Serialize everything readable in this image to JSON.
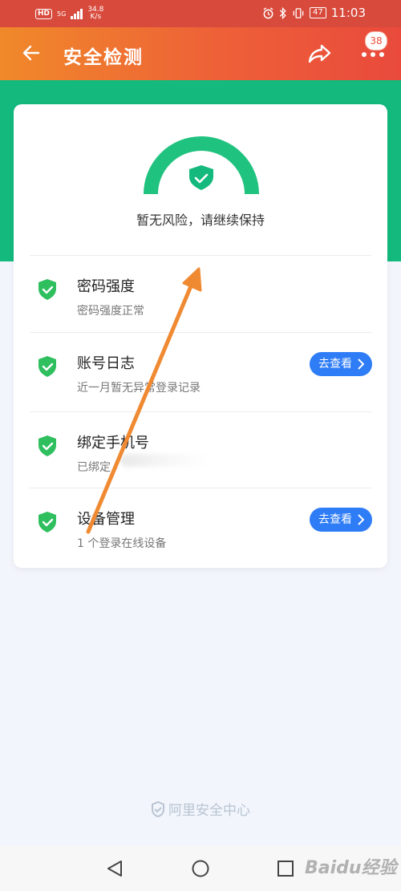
{
  "status_bar": {
    "hd": "HD",
    "network_type": "5G",
    "speed_value": "34.8",
    "speed_unit": "K/s",
    "battery": "47",
    "time": "11:03"
  },
  "header": {
    "title": "安全检测",
    "badge_count": "38"
  },
  "summary": {
    "status_text": "暂无风险，请继续保持"
  },
  "items": [
    {
      "name": "密码强度",
      "desc": "密码强度正常",
      "action": ""
    },
    {
      "name": "账号日志",
      "desc": "近一月暂无异常登录记录",
      "action": "去查看"
    },
    {
      "name": "绑定手机号",
      "desc": "已绑定",
      "action": ""
    },
    {
      "name": "设备管理",
      "desc": "1 个登录在线设备",
      "action": "去查看"
    }
  ],
  "footer": {
    "brand": "阿里安全中心"
  },
  "watermark": "Baidu经验",
  "colors": {
    "header_start": "#f0892a",
    "header_end": "#e94a3c",
    "safe_green": "#13b97d",
    "button_blue": "#2e7cf6"
  },
  "icons": [
    "back-arrow-icon",
    "share-icon",
    "more-icon",
    "shield-check-icon",
    "chevron-right-icon",
    "back-nav-icon",
    "home-nav-icon",
    "recents-nav-icon"
  ]
}
